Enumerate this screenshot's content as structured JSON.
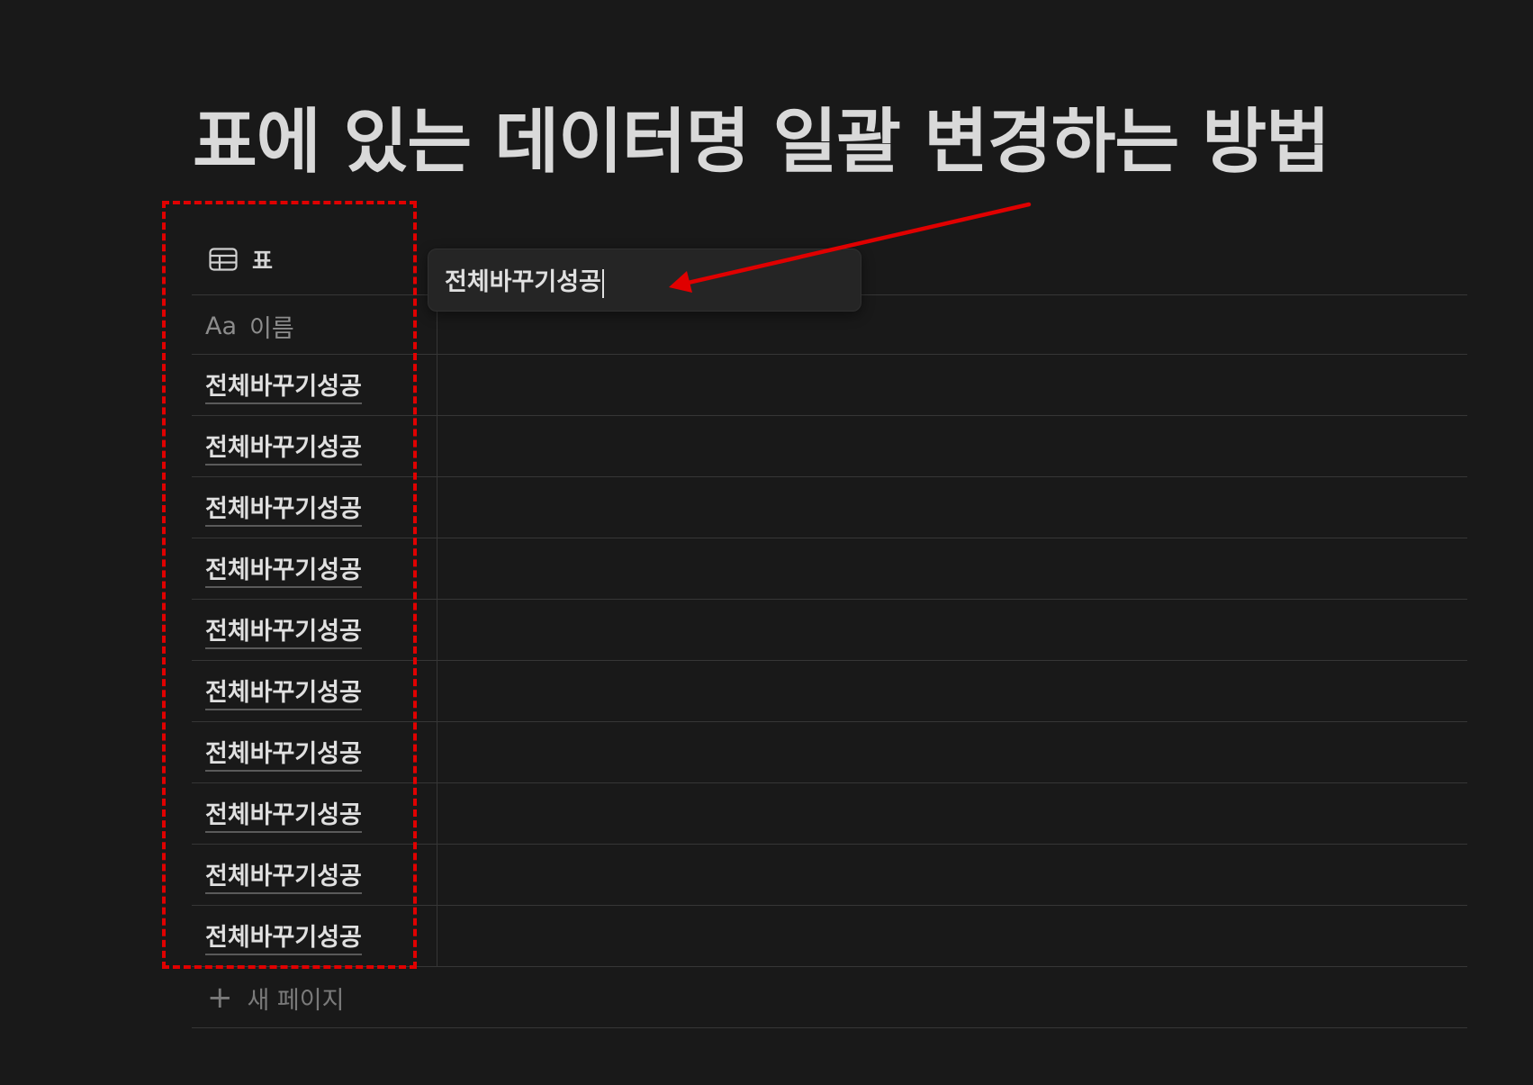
{
  "page_title": "표에 있는 데이터명 일괄 변경하는 방법",
  "view_tab": {
    "icon": "table-icon",
    "label": "표"
  },
  "column_header": {
    "icon": "aa-text-icon",
    "icon_text": "Aa",
    "label": "이름"
  },
  "rows": [
    "전체바꾸기성공",
    "전체바꾸기성공",
    "전체바꾸기성공",
    "전체바꾸기성공",
    "전체바꾸기성공",
    "전체바꾸기성공",
    "전체바꾸기성공",
    "전체바꾸기성공",
    "전체바꾸기성공",
    "전체바꾸기성공"
  ],
  "new_page": {
    "icon": "plus-icon",
    "icon_text": "+",
    "label": "새 페이지"
  },
  "edit_popup": {
    "value": "전체바꾸기성공"
  },
  "annotation": {
    "box_color": "#e00000",
    "arrow_color": "#e00000"
  }
}
